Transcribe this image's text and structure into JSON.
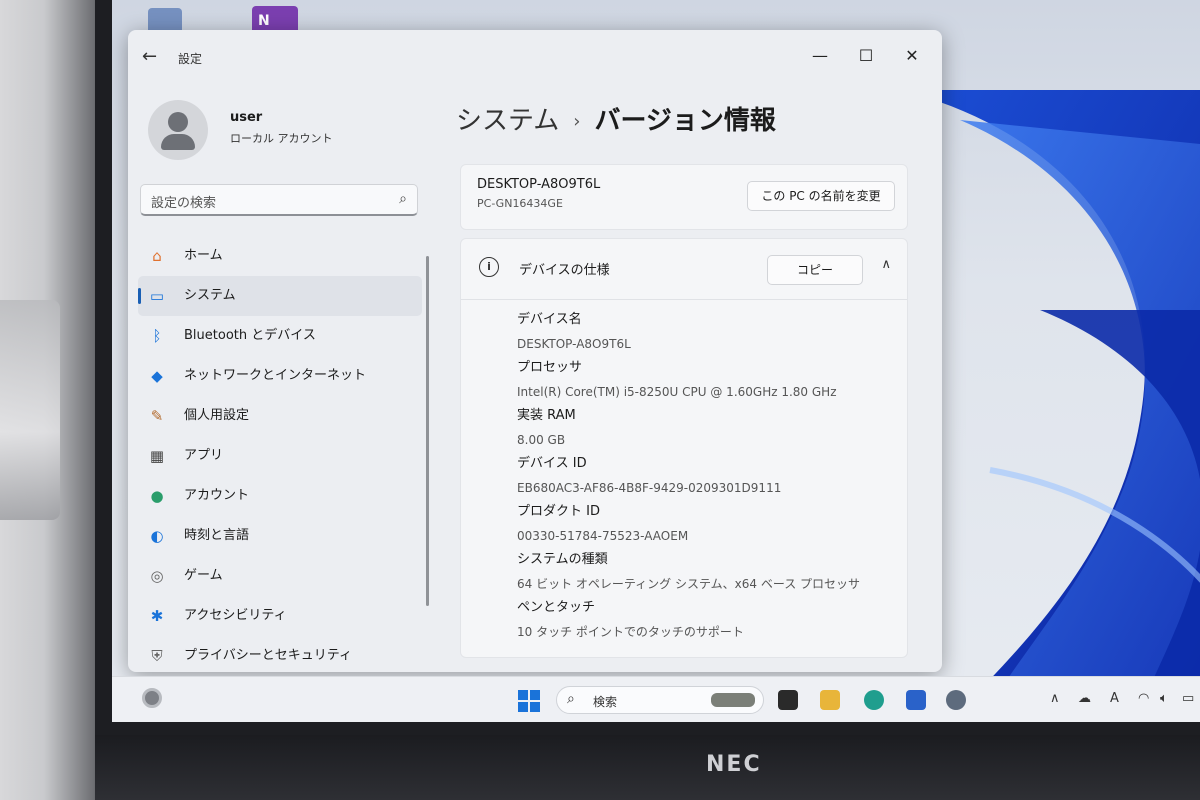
{
  "window": {
    "title": "設定",
    "back_icon": "←",
    "minimize_icon": "—",
    "maximize_icon": "☐",
    "close_icon": "✕"
  },
  "profile": {
    "name": "user",
    "account_type": "ローカル アカウント"
  },
  "search": {
    "placeholder": "設定の検索"
  },
  "sidebar": {
    "items": [
      {
        "label": "ホーム",
        "icon": "home-icon",
        "glyph": "⌂",
        "color": "#e0712f"
      },
      {
        "label": "システム",
        "icon": "system-icon",
        "glyph": "▭",
        "color": "#1a73d9",
        "active": true
      },
      {
        "label": "Bluetooth とデバイス",
        "icon": "bluetooth-icon",
        "glyph": "ᛒ",
        "color": "#1a73d9"
      },
      {
        "label": "ネットワークとインターネット",
        "icon": "wifi-icon",
        "glyph": "◆",
        "color": "#1a73d9"
      },
      {
        "label": "個人用設定",
        "icon": "brush-icon",
        "glyph": "✎",
        "color": "#b36a2d"
      },
      {
        "label": "アプリ",
        "icon": "apps-icon",
        "glyph": "▦",
        "color": "#444"
      },
      {
        "label": "アカウント",
        "icon": "account-icon",
        "glyph": "●",
        "color": "#2a9d6b"
      },
      {
        "label": "時刻と言語",
        "icon": "globe-icon",
        "glyph": "◐",
        "color": "#1a73d9"
      },
      {
        "label": "ゲーム",
        "icon": "gamepad-icon",
        "glyph": "◎",
        "color": "#666"
      },
      {
        "label": "アクセシビリティ",
        "icon": "accessibility-icon",
        "glyph": "✱",
        "color": "#1a73d9"
      },
      {
        "label": "プライバシーとセキュリティ",
        "icon": "shield-icon",
        "glyph": "⛨",
        "color": "#666"
      }
    ]
  },
  "breadcrumb": {
    "parent": "システム",
    "separator": "›",
    "current": "バージョン情報"
  },
  "pc": {
    "name": "DESKTOP-A8O9T6L",
    "model": "PC-GN16434GE",
    "rename_button": "この PC の名前を変更"
  },
  "device_specs": {
    "title": "デバイスの仕様",
    "copy_button": "コピー",
    "collapse_icon": "∧",
    "items": [
      {
        "label": "デバイス名",
        "value": "DESKTOP-A8O9T6L"
      },
      {
        "label": "プロセッサ",
        "value": "Intel(R) Core(TM) i5-8250U CPU @ 1.60GHz   1.80 GHz"
      },
      {
        "label": "実装 RAM",
        "value": "8.00 GB"
      },
      {
        "label": "デバイス ID",
        "value": "EB680AC3-AF86-4B8F-9429-0209301D9111"
      },
      {
        "label": "プロダクト ID",
        "value": "00330-51784-75523-AAOEM"
      },
      {
        "label": "システムの種類",
        "value": "64 ビット オペレーティング システム、x64 ベース プロセッサ"
      },
      {
        "label": "ペンとタッチ",
        "value": "10 タッチ ポイントでのタッチのサポート"
      }
    ]
  },
  "taskbar": {
    "search_label": "検索",
    "search_icon": "⌕",
    "tray_chevron": "∧",
    "tray_ime": "A"
  },
  "desktop": {
    "onenote_label": "N"
  },
  "laptop": {
    "brand": "NEC"
  }
}
